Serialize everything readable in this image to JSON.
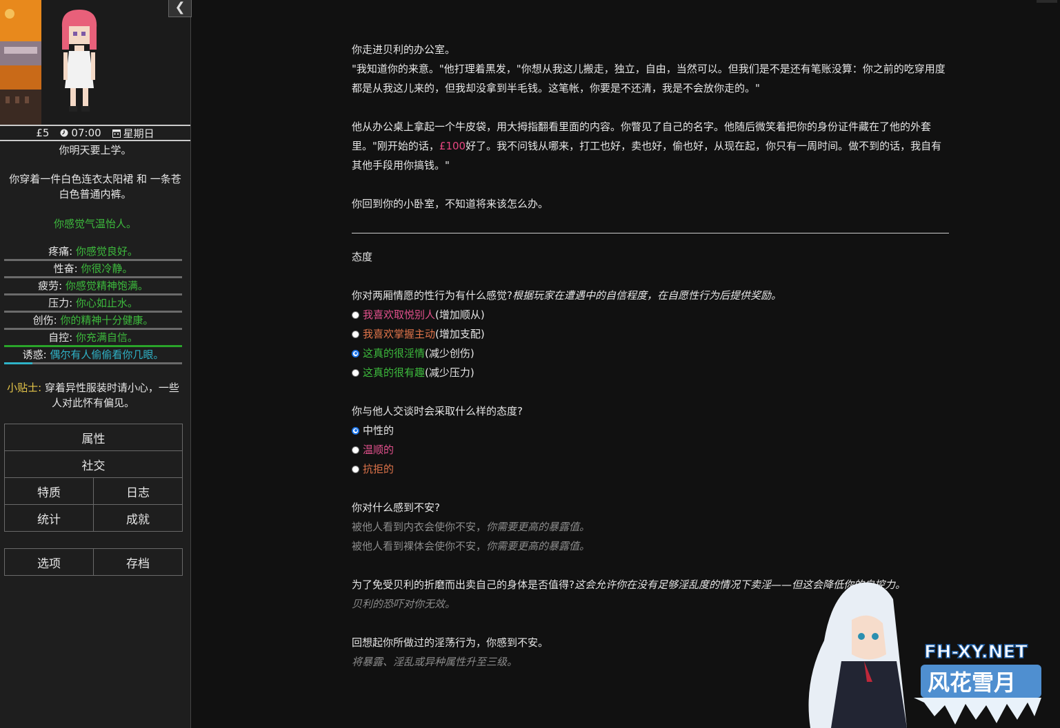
{
  "sidebar": {
    "collapse_icon": "chevron-left-icon",
    "status": {
      "money": "£5",
      "time_icon": "clock-icon",
      "time": "07:00",
      "day_icon": "calendar-icon",
      "day": "星期日"
    },
    "school_note": "你明天要上学。",
    "outfit": "你穿着一件白色连衣太阳裙 和 一条苍白色普通内裤。",
    "weather": "你感觉气温怡人。",
    "stats": [
      {
        "label": "疼痛:",
        "value": "你感觉良好。",
        "color": "#3dbb3d",
        "fill": 0,
        "bar_color": "#3dbb3d"
      },
      {
        "label": "性奋:",
        "value": "你很冷静。",
        "color": "#3dbb3d",
        "fill": 0,
        "bar_color": "#3dbb3d"
      },
      {
        "label": "疲劳:",
        "value": "你感觉精神饱满。",
        "color": "#3dbb3d",
        "fill": 0,
        "bar_color": "#3dbb3d"
      },
      {
        "label": "压力:",
        "value": "你心如止水。",
        "color": "#3dbb3d",
        "fill": 0,
        "bar_color": "#3dbb3d"
      },
      {
        "label": "创伤:",
        "value": "你的精神十分健康。",
        "color": "#3dbb3d",
        "fill": 0,
        "bar_color": "#3dbb3d"
      },
      {
        "label": "自控:",
        "value": "你充满自信。",
        "color": "#3dbb3d",
        "fill": 1.0,
        "bar_color": "#2aa52a"
      },
      {
        "label": "诱惑:",
        "value": "偶尔有人偷偷看你几眼。",
        "color": "#2fb3c8",
        "fill": 0.16,
        "bar_color": "#2fb3c8"
      }
    ],
    "tip_label": "小贴士:",
    "tip_text": "穿着异性服装时请小心，一些人对此怀有偏见。",
    "menu": {
      "attributes": "属性",
      "social": "社交",
      "traits": "特质",
      "journal": "日志",
      "statistics": "统计",
      "achievements": "成就",
      "options": "选项",
      "saves": "存档"
    }
  },
  "passage": {
    "p1_line1": "你走进贝利的办公室。",
    "p1_line2": "\"我知道你的来意。\"他打理着黑发，\"你想从我这儿搬走，独立，自由，当然可以。但我们是不是还有笔账没算：你之前的吃穿用度都是从我这儿来的，但我却没拿到半毛钱。这笔帐，你要是不还清，我是不会放你走的。\"",
    "p2_a": "他从办公桌上拿起一个牛皮袋，用大拇指翻看里面的内容。你瞥见了自己的名字。他随后微笑着把你的身份证件藏在了他的外套里。\"刚开始的话，",
    "p2_money": "£100",
    "p2_b": "好了。我不问钱从哪来，打工也好，卖也好，偷也好，从现在起，你只有一周时间。做不到的话，我自有其他手段用你搞钱。\"",
    "p3": "你回到你的小卧室，不知道将来该怎么办。",
    "section_title": "态度",
    "q1": "你对两厢情愿的性行为有什么感觉?",
    "q1_hint": "根据玩家在遭遇中的自信程度，在自愿性行为后提供奖励。",
    "q1_options": [
      {
        "label": "我喜欢取悦别人",
        "effect": " (增加顺从)",
        "color": "#e2508c",
        "selected": false
      },
      {
        "label": "我喜欢掌握主动",
        "effect": " (增加支配)",
        "color": "#e0744a",
        "selected": false
      },
      {
        "label": "这真的很淫情",
        "effect": " (减少创伤)",
        "color": "#3dbb3d",
        "selected": true
      },
      {
        "label": "这真的很有趣",
        "effect": " (减少压力)",
        "color": "#3dbb3d",
        "selected": false
      }
    ],
    "q2": "你与他人交谈时会采取什么样的态度?",
    "q2_options": [
      {
        "label": "中性的",
        "color": "#e6e6e6",
        "selected": true
      },
      {
        "label": "温顺的",
        "color": "#e2508c",
        "selected": false
      },
      {
        "label": "抗拒的",
        "color": "#e0744a",
        "selected": false
      }
    ],
    "q3": "你对什么感到不安?",
    "q3_line1": "被他人看到内衣会使你不安，",
    "q3_line1_hint": "你需要更高的暴露值。",
    "q3_line2": "被他人看到裸体会使你不安，",
    "q3_line2_hint": "你需要更高的暴露值。",
    "q4": "为了免受贝利的折磨而出卖自己的身体是否值得?",
    "q4_hint": "这会允许你在没有足够淫乱度的情况下卖淫——但这会降低你的自控力。",
    "q4_note": "贝利的恐吓对你无效。",
    "q5": "回想起你所做过的淫荡行为，你感到不安。",
    "q5_note": "将暴露、淫乱或异种属性升至三级。"
  },
  "watermark": {
    "text_top": "FH-XY.NET",
    "text_bottom": "风花雪月"
  }
}
